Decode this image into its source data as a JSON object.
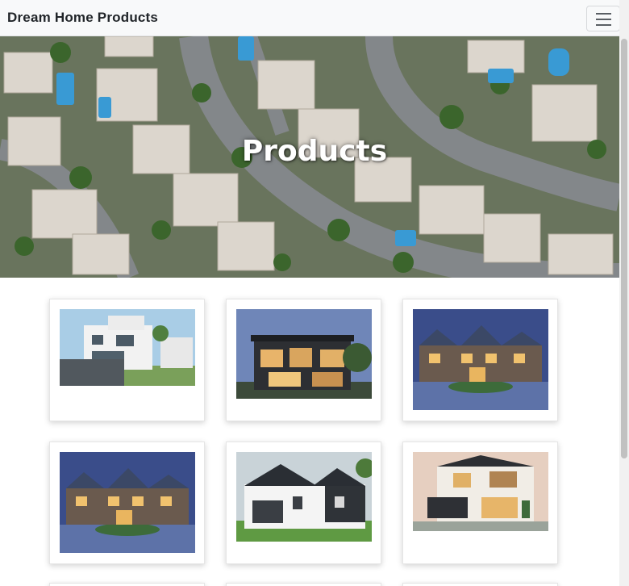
{
  "navbar": {
    "brand": "Dream Home Products",
    "menu_icon": "hamburger-menu-icon"
  },
  "hero": {
    "title": "Products",
    "image": "aerial-suburb-photo"
  },
  "products": [
    {
      "image": "white-modern-house-photo"
    },
    {
      "image": "dark-modern-house-photo"
    },
    {
      "image": "stone-mansion-dusk-photo"
    },
    {
      "image": "stone-mansion-dusk-photo-2"
    },
    {
      "image": "white-farmhouse-photo"
    },
    {
      "image": "two-storey-modern-house-photo"
    }
  ],
  "colors": {
    "navbar_bg": "#f8f9fa",
    "brand_text": "#212529",
    "hero_text": "#ffffff"
  }
}
